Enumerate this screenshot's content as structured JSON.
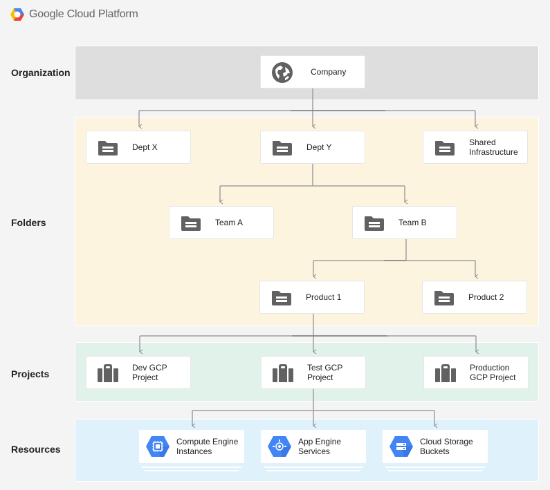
{
  "brand": {
    "name": "Google Cloud Platform",
    "logo_icon": "gcp-hexagon-logo"
  },
  "tiers": {
    "organization": {
      "label": "Organization"
    },
    "folders": {
      "label": "Folders"
    },
    "projects": {
      "label": "Projects"
    },
    "resources": {
      "label": "Resources"
    }
  },
  "nodes": {
    "company": {
      "label": "Company",
      "icon": "globe-icon"
    },
    "dept_x": {
      "label": "Dept X",
      "icon": "folder-icon"
    },
    "dept_y": {
      "label": "Dept Y",
      "icon": "folder-icon"
    },
    "shared_infra": {
      "label_line1": "Shared",
      "label_line2": "Infrastructure",
      "icon": "folder-icon"
    },
    "team_a": {
      "label": "Team A",
      "icon": "folder-icon"
    },
    "team_b": {
      "label": "Team B",
      "icon": "folder-icon"
    },
    "product_1": {
      "label": "Product 1",
      "icon": "folder-icon"
    },
    "product_2": {
      "label": "Product 2",
      "icon": "folder-icon"
    },
    "dev_project": {
      "label_line1": "Dev GCP",
      "label_line2": "Project",
      "icon": "briefcase-icon"
    },
    "test_project": {
      "label_line1": "Test GCP",
      "label_line2": "Project",
      "icon": "briefcase-icon"
    },
    "prod_project": {
      "label_line1": "Production",
      "label_line2": "GCP Project",
      "icon": "briefcase-icon"
    },
    "compute_engine": {
      "label_line1": "Compute Engine",
      "label_line2": "Instances",
      "icon": "compute-engine-icon"
    },
    "app_engine": {
      "label_line1": "App Engine",
      "label_line2": "Services",
      "icon": "app-engine-icon"
    },
    "cloud_storage": {
      "label_line1": "Cloud Storage",
      "label_line2": "Buckets",
      "icon": "cloud-storage-icon"
    }
  },
  "colors": {
    "org_band": "#dedede",
    "folders_band": "#fdf4e0",
    "projects_band": "#e1f2ea",
    "resources_band": "#dff2fc",
    "icon_gray": "#616161",
    "resource_blue": "#4285f4",
    "connector": "#9e9e9e"
  }
}
